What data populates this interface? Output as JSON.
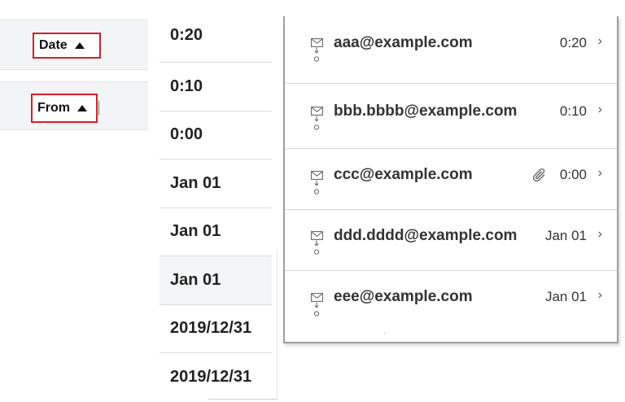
{
  "sort_header": {
    "date_label": "Date",
    "from_label": "From"
  },
  "time_column": [
    "0:20",
    "0:10",
    "0:00",
    "Jan 01",
    "Jan 01",
    "Jan 01",
    "2019/12/31",
    "2019/12/31"
  ],
  "mail_list": [
    {
      "sender": "aaa@example.com",
      "time": "0:20",
      "attachment": false
    },
    {
      "sender": "bbb.bbbb@example.com",
      "time": "0:10",
      "attachment": false
    },
    {
      "sender": "ccc@example.com",
      "time": "0:00",
      "attachment": true
    },
    {
      "sender": "ddd.dddd@example.com",
      "time": "Jan 01",
      "attachment": false
    },
    {
      "sender": "eee@example.com",
      "time": "Jan 01",
      "attachment": false
    }
  ],
  "icons": {
    "sort_ascending": "triangle-up-icon",
    "mail": "envelope-icon",
    "status": "arrow-down-circle-icon",
    "attachment": "paperclip-icon",
    "open": "chevron-right-icon"
  },
  "chevron_glyph": "›",
  "colors": {
    "highlight_border": "#d0202a",
    "header_background": "#f3f4f5",
    "panel_border": "#9d9d9d",
    "row_divider": "#d9d9d9",
    "text": "#222222"
  }
}
